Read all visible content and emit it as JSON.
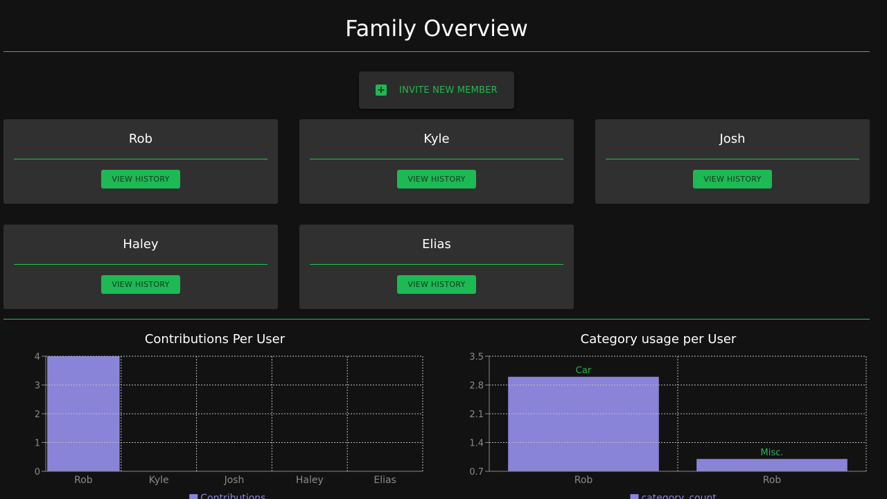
{
  "page": {
    "title": "Family Overview"
  },
  "invite": {
    "label": "INVITE NEW MEMBER",
    "icon": "plus-square-icon"
  },
  "members": [
    {
      "name": "Rob",
      "button": "VIEW HISTORY"
    },
    {
      "name": "Kyle",
      "button": "VIEW HISTORY"
    },
    {
      "name": "Josh",
      "button": "VIEW HISTORY"
    },
    {
      "name": "Haley",
      "button": "VIEW HISTORY"
    },
    {
      "name": "Elias",
      "button": "VIEW HISTORY"
    }
  ],
  "colors": {
    "accent": "#1db954",
    "bar": "#8a84d8",
    "card": "#303030",
    "background": "#121212"
  },
  "chart_data": [
    {
      "type": "bar",
      "title": "Contributions Per User",
      "categories": [
        "Rob",
        "Kyle",
        "Josh",
        "Haley",
        "Elias"
      ],
      "series": [
        {
          "name": "Contributions",
          "values": [
            4,
            0,
            0,
            0,
            0
          ]
        }
      ],
      "yticks": [
        "0",
        "1",
        "2",
        "3",
        "4"
      ],
      "ylim": [
        0,
        4
      ],
      "grid": true,
      "legend": "bottom"
    },
    {
      "type": "bar",
      "title": "Category usage per User",
      "categories": [
        "Rob",
        "Rob"
      ],
      "bar_labels": [
        "Car",
        "Misc."
      ],
      "series": [
        {
          "name": "category_count",
          "values": [
            3,
            1
          ]
        }
      ],
      "yticks": [
        "0.7",
        "1.4",
        "2.1",
        "2.8",
        "3.5"
      ],
      "ylim": [
        0.7,
        3.5
      ],
      "grid": true,
      "legend": "bottom"
    }
  ]
}
